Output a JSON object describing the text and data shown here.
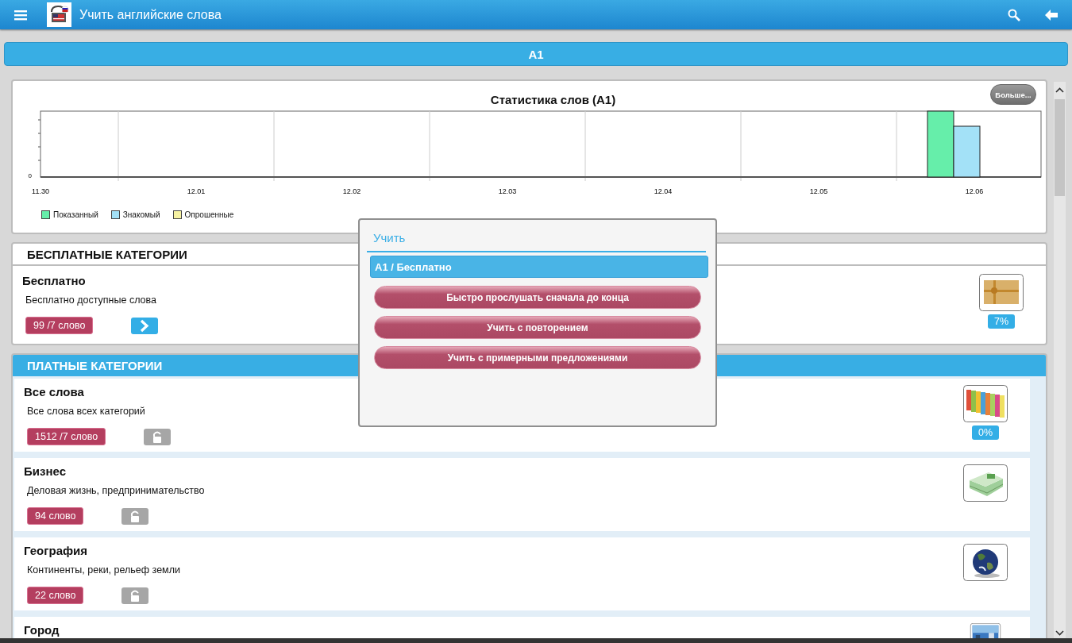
{
  "app_bar": {
    "title": "Учить английские слова"
  },
  "level_bar": {
    "label": "A1"
  },
  "stats": {
    "title": "Статистика слов (A1)",
    "more_button": "Больше...",
    "y_axis_label": "0",
    "x_labels": [
      "11.30",
      "12.01",
      "12.02",
      "12.03",
      "12.04",
      "12.05",
      "12.06"
    ],
    "legend": [
      {
        "label": "Показанный",
        "color": "#66eeaa"
      },
      {
        "label": "Знакомый",
        "color": "#a3e1f7"
      },
      {
        "label": "Опрошенные",
        "color": "#f6f2a2"
      }
    ]
  },
  "free_section": {
    "heading": "БЕСПЛАТНЫЕ КАТЕГОРИИ",
    "items": [
      {
        "name": "Бесплатно",
        "description": "Бесплатно доступные слова",
        "count": "99 /7 слово",
        "kind": "open",
        "progress": "7%"
      }
    ]
  },
  "paid_section": {
    "heading": "ПЛАТНЫЕ КАТЕГОРИИ",
    "items": [
      {
        "name": "Все слова",
        "description": "Все слова всех категорий",
        "count": "1512 /7 слово",
        "kind": "locked",
        "progress": "0%"
      },
      {
        "name": "Бизнес",
        "description": "Деловая жизнь, предпринимательство",
        "count": "94 слово",
        "kind": "locked"
      },
      {
        "name": "География",
        "description": "Континенты, реки, рельеф земли",
        "count": "22 слово",
        "kind": "locked"
      },
      {
        "name": "Город"
      }
    ]
  },
  "dialog": {
    "title": "Учить",
    "subtitle": "A1 / Бесплатно",
    "buttons": [
      "Быстро прослушать сначала до конца",
      "Учить с повторением",
      "Учить с примерными предложениями"
    ]
  }
}
